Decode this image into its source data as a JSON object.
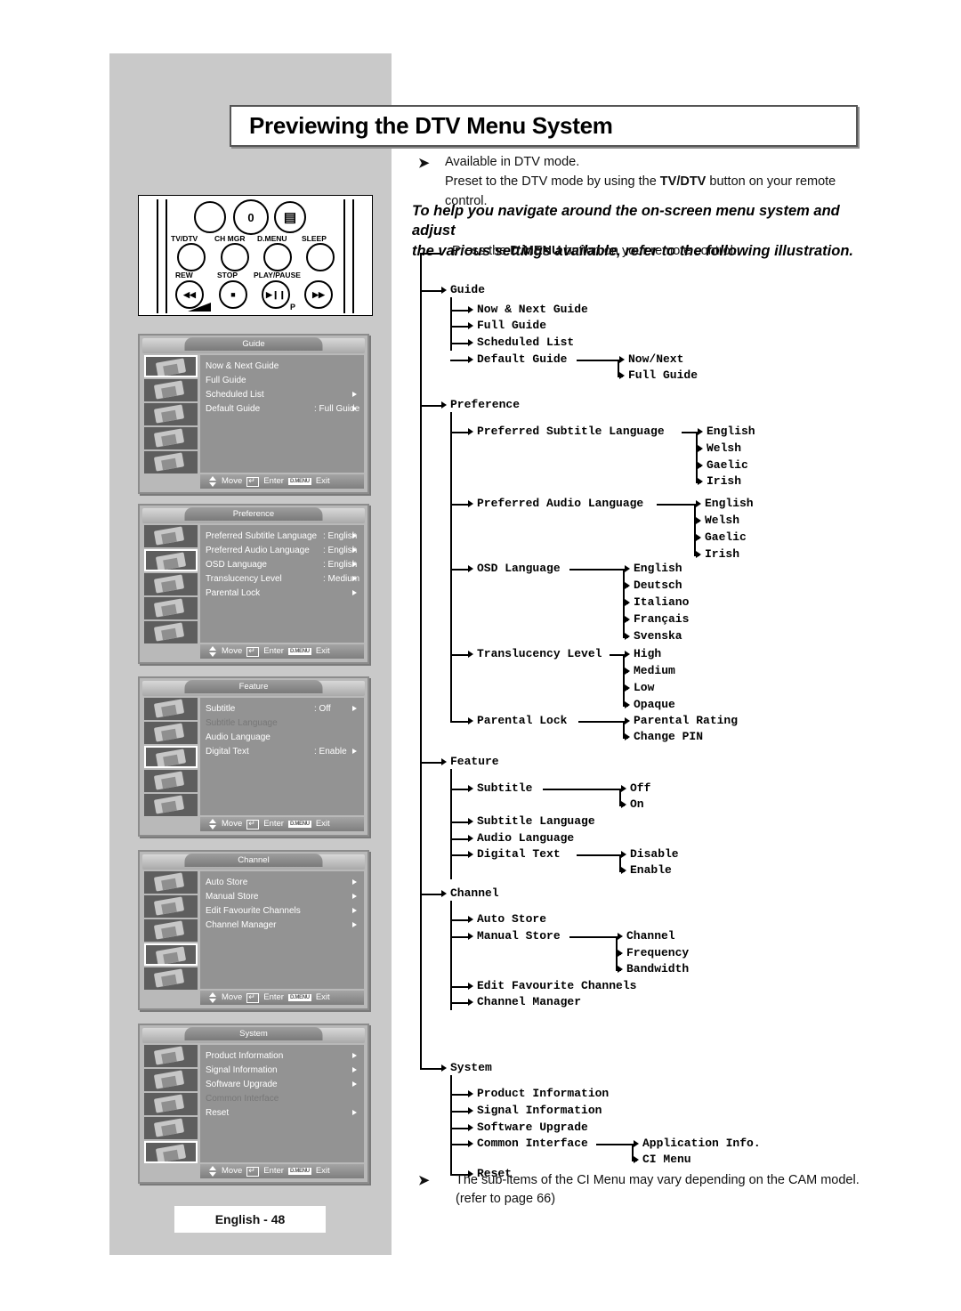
{
  "page": {
    "title": "Previewing the DTV Menu System",
    "page_label": "English - 48"
  },
  "notes": {
    "arrow_glyph": "➤",
    "available_line1": "Available in DTV mode.",
    "available_line2_pre": "Preset to the DTV mode by using the ",
    "available_line2_bold": "TV/DTV",
    "available_line2_post": " button on your remote control.",
    "intro_line1": "To help you navigate around the on-screen menu system and adjust",
    "intro_line2": "the various settings available, refer to the following illustration.",
    "footnote_line1": "The sub-items of the CI Menu may vary depending on the CAM model.",
    "footnote_line2": "(refer to page 66)"
  },
  "remote": {
    "zero_label": "0",
    "dmenu_glyph": "▤",
    "labels_row1": [
      "TV/DTV",
      "CH MGR",
      "D.MENU",
      "SLEEP"
    ],
    "labels_row2": [
      "REW",
      "STOP",
      "PLAY/PAUSE"
    ],
    "rew_glyph": "◀◀",
    "stop_glyph": "■",
    "play_glyph": "▶❙❙",
    "ff_glyph": "▶▶",
    "p_label": "P"
  },
  "osd_footer": {
    "move": "Move",
    "enter": "Enter",
    "exit": "Exit",
    "menu_key": "D.MENU"
  },
  "osd_panels": [
    {
      "title": "Guide",
      "selected_index": 0,
      "rows": [
        {
          "label": "Now & Next Guide",
          "value": "",
          "arrow": false,
          "dim": false
        },
        {
          "label": "Full Guide",
          "value": "",
          "arrow": false,
          "dim": false
        },
        {
          "label": "Scheduled List",
          "value": "",
          "arrow": true,
          "dim": false
        },
        {
          "label": "Default Guide",
          "value": ": Full Guide",
          "arrow": true,
          "dim": false
        }
      ]
    },
    {
      "title": "Preference",
      "selected_index": 1,
      "rows": [
        {
          "label": "Preferred Subtitle Language",
          "value": ": English",
          "arrow": true,
          "dim": false
        },
        {
          "label": "Preferred Audio Language",
          "value": ": English",
          "arrow": true,
          "dim": false
        },
        {
          "label": "OSD Language",
          "value": ": English",
          "arrow": true,
          "dim": false
        },
        {
          "label": "Translucency Level",
          "value": ": Medium",
          "arrow": true,
          "dim": false
        },
        {
          "label": "Parental Lock",
          "value": "",
          "arrow": true,
          "dim": false
        }
      ]
    },
    {
      "title": "Feature",
      "selected_index": 2,
      "rows": [
        {
          "label": "Subtitle",
          "value": ": Off",
          "arrow": true,
          "dim": false
        },
        {
          "label": "Subtitle Language",
          "value": "",
          "arrow": false,
          "dim": true
        },
        {
          "label": "Audio Language",
          "value": "",
          "arrow": false,
          "dim": false
        },
        {
          "label": "Digital Text",
          "value": ": Enable",
          "arrow": true,
          "dim": false
        }
      ]
    },
    {
      "title": "Channel",
      "selected_index": 3,
      "rows": [
        {
          "label": "Auto Store",
          "value": "",
          "arrow": true,
          "dim": false
        },
        {
          "label": "Manual Store",
          "value": "",
          "arrow": true,
          "dim": false
        },
        {
          "label": "Edit Favourite Channels",
          "value": "",
          "arrow": true,
          "dim": false
        },
        {
          "label": "Channel Manager",
          "value": "",
          "arrow": true,
          "dim": false
        }
      ]
    },
    {
      "title": "System",
      "selected_index": 4,
      "rows": [
        {
          "label": "Product Information",
          "value": "",
          "arrow": true,
          "dim": false
        },
        {
          "label": "Signal Information",
          "value": "",
          "arrow": true,
          "dim": false
        },
        {
          "label": "Software Upgrade",
          "value": "",
          "arrow": true,
          "dim": false
        },
        {
          "label": "Common Interface",
          "value": "",
          "arrow": false,
          "dim": true
        },
        {
          "label": "Reset",
          "value": "",
          "arrow": true,
          "dim": false
        }
      ]
    }
  ],
  "tree": {
    "root_text_pre": "Press the ",
    "root_text_bold": "D.MENU",
    "root_text_post": " button on your remote control.",
    "l1": {
      "guide": "Guide",
      "preference": "Preference",
      "feature": "Feature",
      "channel": "Channel",
      "system": "System"
    },
    "guide_children": [
      "Now & Next Guide",
      "Full Guide",
      "Scheduled List",
      "Default Guide"
    ],
    "default_guide_children": [
      "Now/Next",
      "Full Guide"
    ],
    "preference_children": [
      "Preferred Subtitle Language",
      "Preferred Audio Language",
      "OSD Language",
      "Translucency Level",
      "Parental Lock"
    ],
    "pref_subtitle_langs": [
      "English",
      "Welsh",
      "Gaelic",
      "Irish"
    ],
    "pref_audio_langs": [
      "English",
      "Welsh",
      "Gaelic",
      "Irish"
    ],
    "osd_langs": [
      "English",
      "Deutsch",
      "Italiano",
      "Français",
      "Svenska"
    ],
    "translucency_levels": [
      "High",
      "Medium",
      "Low",
      "Opaque"
    ],
    "parental_lock_children": [
      "Parental Rating",
      "Change PIN"
    ],
    "feature_children": [
      "Subtitle",
      "Subtitle Language",
      "Audio Language",
      "Digital Text"
    ],
    "subtitle_values": [
      "Off",
      "On"
    ],
    "digital_text_values": [
      "Disable",
      "Enable"
    ],
    "channel_children": [
      "Auto Store",
      "Manual Store",
      "Edit Favourite Channels",
      "Channel Manager"
    ],
    "manual_store_children": [
      "Channel",
      "Frequency",
      "Bandwidth"
    ],
    "system_children": [
      "Product Information",
      "Signal Information",
      "Software Upgrade",
      "Common Interface",
      "Reset"
    ],
    "common_interface_children": [
      "Application Info.",
      "CI Menu"
    ]
  },
  "colors": {
    "page_bg": "#ffffff",
    "sidebar_bg": "#c9c9c9",
    "osd_body": "#939393",
    "osd_frame": "#b9b9b9",
    "text": "#000000"
  }
}
